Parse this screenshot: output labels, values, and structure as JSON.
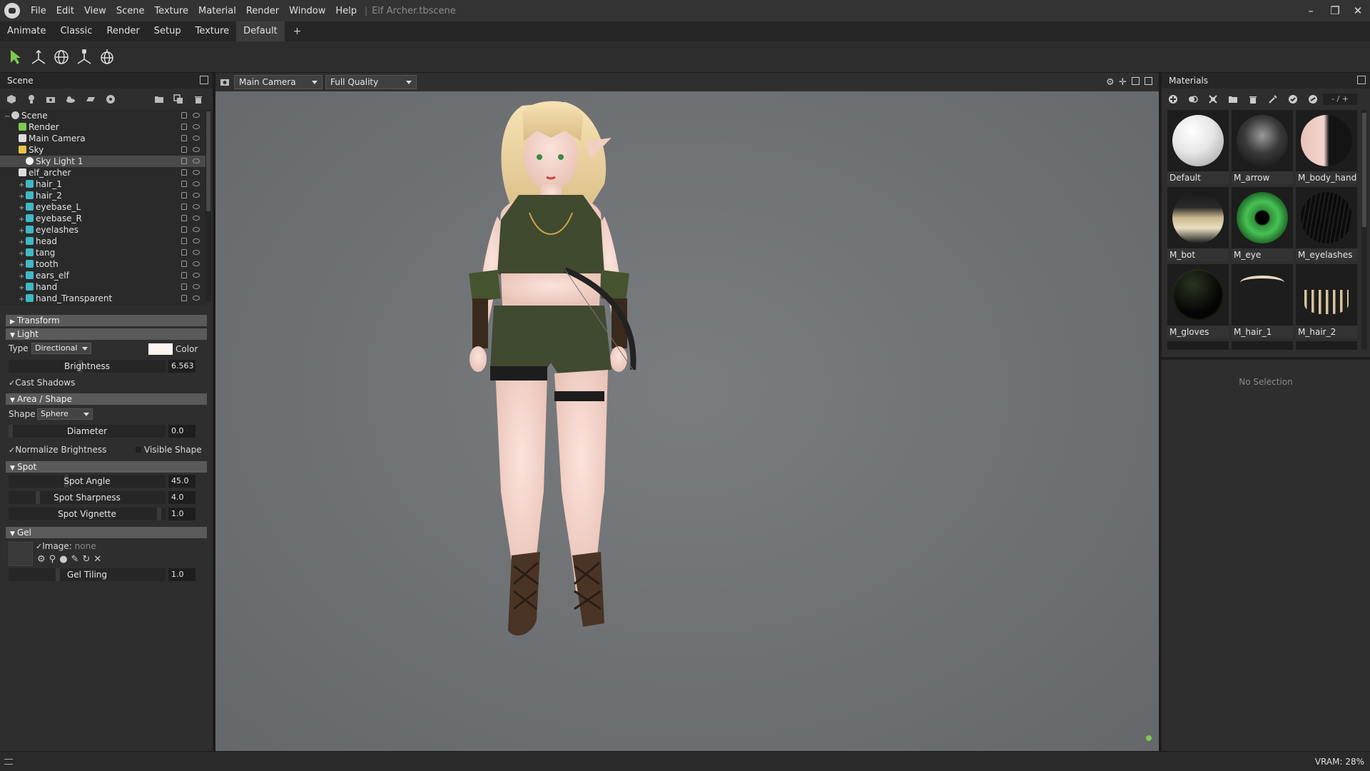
{
  "app": {
    "doc_title": "Elf Archer.tbscene",
    "separator": "|",
    "menu": [
      "File",
      "Edit",
      "View",
      "Scene",
      "Texture",
      "Material",
      "Render",
      "Window",
      "Help"
    ]
  },
  "tabs": [
    "Animate",
    "Classic",
    "Render",
    "Setup",
    "Texture",
    "Default"
  ],
  "active_tab": "Default",
  "tab_add": "+",
  "scene_panel": {
    "title": "Scene",
    "tree": [
      {
        "label": "Scene",
        "depth": 0,
        "icon": "scene-icon"
      },
      {
        "label": "Render",
        "depth": 1,
        "icon": "render-gear-icon"
      },
      {
        "label": "Main Camera",
        "depth": 1,
        "icon": "camera-icon"
      },
      {
        "label": "Sky",
        "depth": 1,
        "icon": "sky-icon"
      },
      {
        "label": "Sky Light 1",
        "depth": 2,
        "icon": "light-bulb-icon",
        "selected": true
      },
      {
        "label": "elf_archer",
        "depth": 1,
        "icon": "model-icon"
      },
      {
        "label": "hair_1",
        "depth": 2,
        "icon": "mesh-icon"
      },
      {
        "label": "hair_2",
        "depth": 2,
        "icon": "mesh-icon"
      },
      {
        "label": "eyebase_L",
        "depth": 2,
        "icon": "mesh-icon"
      },
      {
        "label": "eyebase_R",
        "depth": 2,
        "icon": "mesh-icon"
      },
      {
        "label": "eyelashes",
        "depth": 2,
        "icon": "mesh-icon"
      },
      {
        "label": "head",
        "depth": 2,
        "icon": "mesh-icon"
      },
      {
        "label": "tang",
        "depth": 2,
        "icon": "mesh-icon"
      },
      {
        "label": "tooth",
        "depth": 2,
        "icon": "mesh-icon"
      },
      {
        "label": "ears_elf",
        "depth": 2,
        "icon": "mesh-icon"
      },
      {
        "label": "hand",
        "depth": 2,
        "icon": "mesh-icon"
      },
      {
        "label": "hand_Transparent",
        "depth": 2,
        "icon": "mesh-icon"
      }
    ]
  },
  "properties": {
    "transform_header": "Transform",
    "light_header": "Light",
    "type_label": "Type",
    "type_value": "Directional",
    "color_label": "Color",
    "brightness_label": "Brightness",
    "brightness_value": "6.563",
    "cast_shadows_label": "Cast Shadows",
    "area_header": "Area / Shape",
    "shape_label": "Shape",
    "shape_value": "Sphere",
    "diameter_label": "Diameter",
    "diameter_value": "0.0",
    "normalize_label": "Normalize Brightness",
    "visible_shape_label": "Visible Shape",
    "spot_header": "Spot",
    "spot_angle_label": "Spot Angle",
    "spot_angle_value": "45.0",
    "spot_sharpness_label": "Spot Sharpness",
    "spot_sharpness_value": "4.0",
    "spot_vignette_label": "Spot Vignette",
    "spot_vignette_value": "1.0",
    "gel_header": "Gel",
    "image_label": "Image:",
    "image_value": "none",
    "gel_tiling_label": "Gel Tiling",
    "gel_tiling_value": "1.0"
  },
  "viewport": {
    "camera": "Main Camera",
    "quality": "Full Quality"
  },
  "materials_panel": {
    "title": "Materials",
    "page_indicator": "- / +",
    "items": [
      "Default",
      "M_arrow",
      "M_body_hand",
      "M_bot",
      "M_eye",
      "M_eyelashes",
      "M_gloves",
      "M_hair_1",
      "M_hair_2"
    ],
    "no_selection": "No Selection"
  },
  "status": {
    "vram": "VRAM: 28%"
  },
  "colors": {
    "accent_green": "#7ec850",
    "light_color": "#fff4f2",
    "tree_icon_teal": "#3fb8c8"
  }
}
